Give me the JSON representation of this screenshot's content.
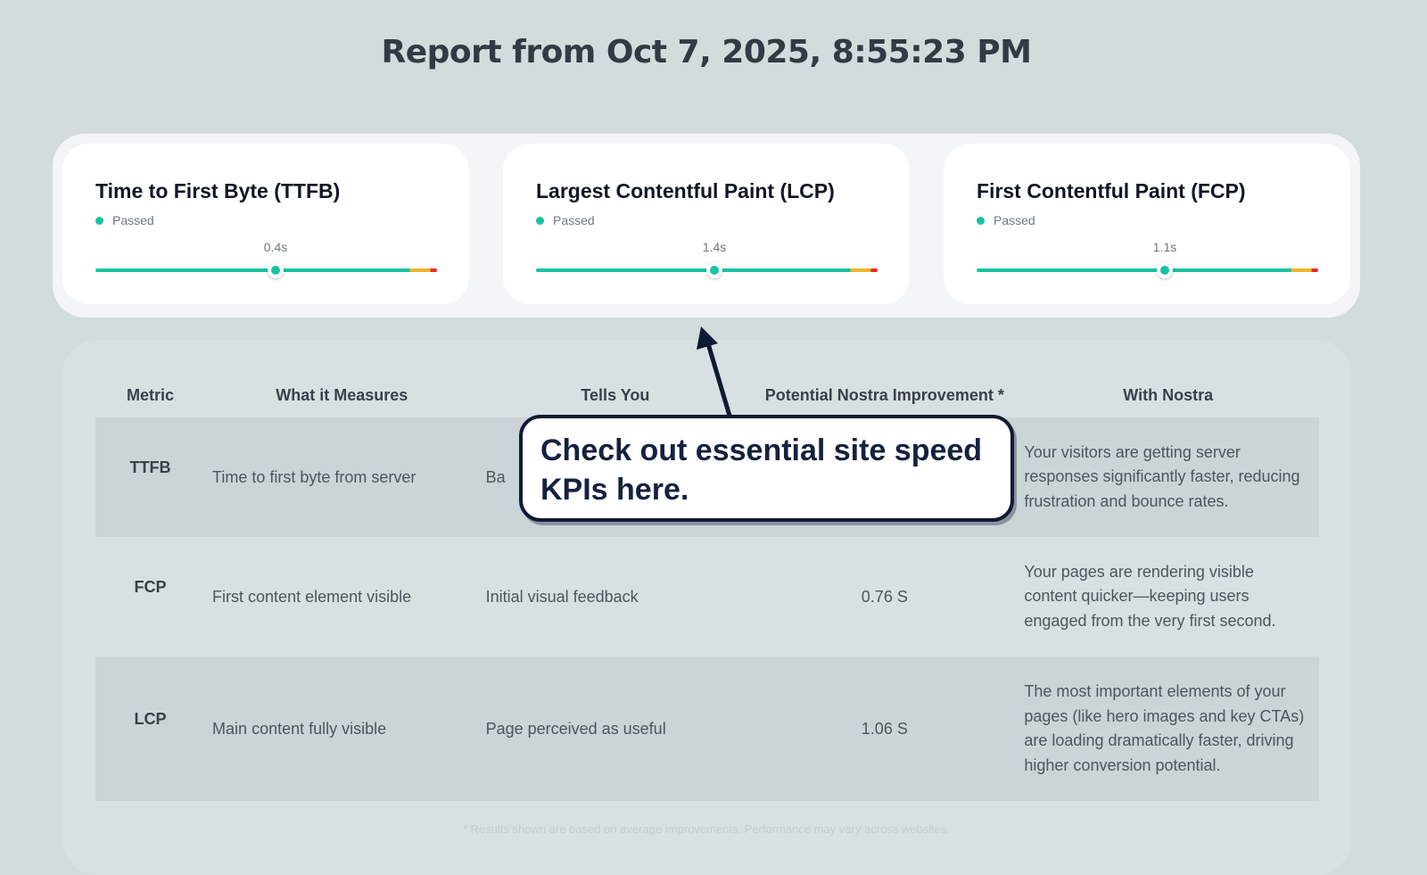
{
  "report": {
    "title": "Report from Oct 7, 2025, 8:55:23 PM"
  },
  "kpis": [
    {
      "title": "Time to First Byte (TTFB)",
      "status": "Passed",
      "value": "0.4s",
      "marker_fraction": 0.52
    },
    {
      "title": "Largest Contentful Paint (LCP)",
      "status": "Passed",
      "value": "1.4s",
      "marker_fraction": 0.515
    },
    {
      "title": "First Contentful Paint (FCP)",
      "status": "Passed",
      "value": "1.1s",
      "marker_fraction": 0.545
    }
  ],
  "colors": {
    "good": "#17c3a3",
    "needs_improvement": "#f0b429",
    "poor": "#ee2a2a",
    "callout_border": "#111a33"
  },
  "table": {
    "headers": [
      "Metric",
      "What it Measures",
      "Tells You",
      "Potential Nostra Improvement *",
      "With Nostra"
    ],
    "rows": [
      {
        "metric": "TTFB",
        "measures": "Time to first byte from server",
        "tells": "Ba",
        "improvement": "",
        "with_nostra": "Your visitors are getting server responses significantly faster, reducing frustration and bounce rates."
      },
      {
        "metric": "FCP",
        "measures": "First content element visible",
        "tells": "Initial visual feedback",
        "improvement": "0.76 S",
        "with_nostra": "Your pages are rendering visible content quicker—keeping users engaged from the very first second."
      },
      {
        "metric": "LCP",
        "measures": "Main content fully visible",
        "tells": "Page perceived as useful",
        "improvement": "1.06 S",
        "with_nostra": "The most important elements of your pages (like hero images and key CTAs) are loading dramatically faster, driving higher conversion potential."
      }
    ]
  },
  "footnote": "* Results shown are based on average improvements. Performance may vary across websites.",
  "callout": {
    "line1": "Check out essential site speed",
    "line2": "KPIs here."
  }
}
